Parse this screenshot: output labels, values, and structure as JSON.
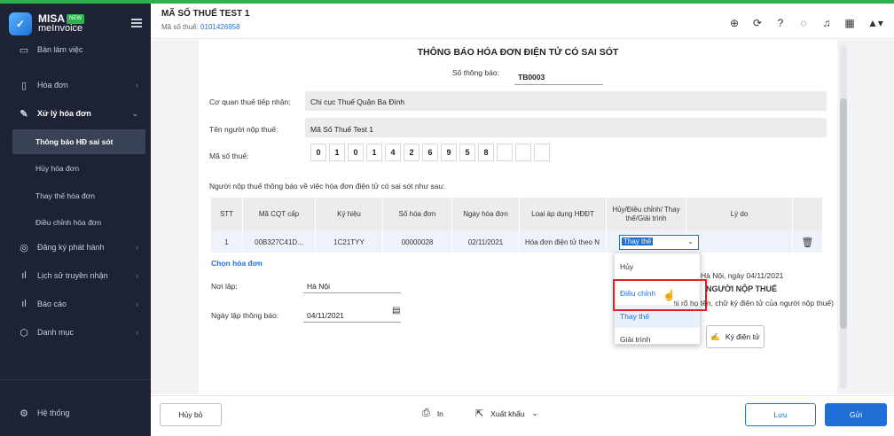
{
  "brand": {
    "name": "MISA",
    "product": "meInvoice",
    "badge": "NEW"
  },
  "sidebar": {
    "items": [
      {
        "label": "Bàn làm việc",
        "icon": "desktop-icon"
      },
      {
        "label": "Hóa đơn",
        "icon": "document-icon"
      },
      {
        "label": "Xử lý hóa đơn",
        "icon": "edit-document-icon"
      },
      {
        "label": "Đăng ký phát hành",
        "icon": "lightbulb-icon"
      },
      {
        "label": "Lịch sử truyền nhận",
        "icon": "bar-chart-icon"
      },
      {
        "label": "Báo cáo",
        "icon": "report-chart-icon"
      },
      {
        "label": "Danh mục",
        "icon": "box-icon"
      }
    ],
    "subitems": [
      "Thông báo HĐ sai sót",
      "Hủy hóa đơn",
      "Thay thế hóa đơn",
      "Điều chỉnh hóa đơn"
    ],
    "settings": "Hệ thống"
  },
  "header": {
    "company": "MÃ SỐ THUẾ TEST 1",
    "taxid_label": "Mã số thuế:",
    "taxid_value": "0101426958"
  },
  "form": {
    "title": "THÔNG BÁO HÓA ĐƠN ĐIỆN TỬ CÓ SAI SÓT",
    "notice_no_label": "Số thông báo:",
    "notice_no": "TB0003",
    "tax_office_label": "Cơ quan thuế tiếp nhận:",
    "tax_office": "Chi cục Thuế Quận Ba Đình",
    "taxpayer_label": "Tên người nộp thuế:",
    "taxpayer": "Mã Số Thuế Test 1",
    "taxcode_label": "Mã số thuế:",
    "taxcode_digits": [
      "0",
      "1",
      "0",
      "1",
      "4",
      "2",
      "6",
      "9",
      "5",
      "8",
      "",
      "",
      ""
    ],
    "intro": "Người nộp thuế thông báo về việc hóa đơn điện tử có sai sót như sau:",
    "table": {
      "headers": [
        "STT",
        "Mã CQT cấp",
        "Ký hiệu",
        "Số hóa đơn",
        "Ngày hóa đơn",
        "Loại áp dụng HĐĐT",
        "Hủy/Điều chỉnh/ Thay thế/Giải trình",
        "Lý do",
        ""
      ],
      "row": [
        "1",
        "00B327C41D...",
        "1C21TYY",
        "00000028",
        "02/11/2021",
        "Hóa đơn điện tử theo N"
      ],
      "select_value": "Thay thế",
      "options": [
        "Hủy",
        "Điều chỉnh",
        "Thay thế",
        "Giải trình"
      ]
    },
    "choose_invoice": "Chọn hóa đơn",
    "place_label": "Nơi lập:",
    "place": "Hà Nội",
    "date_label": "Ngày lập thông báo:",
    "date": "04/11/2021",
    "sign_place_date": "Hà Nội, ngày 04/11/2021",
    "signer_title": "NGƯỜI NỘP THUẾ",
    "signer_note": "(Ký, ghi rõ họ tên, chữ ký điện tử của người nộp thuế)",
    "sign_button": "Ký điện tử"
  },
  "footer": {
    "cancel": "Hủy bỏ",
    "print": "In",
    "export": "Xuất khẩu",
    "save": "Lưu",
    "send": "Gửi"
  },
  "colors": {
    "sidebar": "#1d2235",
    "accent": "#1f6fd6",
    "highlight": "#e02020",
    "send": "#1f6fd6"
  }
}
